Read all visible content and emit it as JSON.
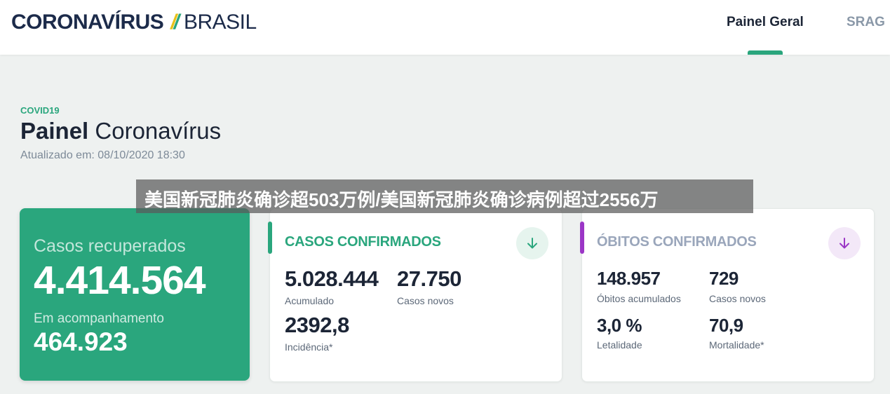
{
  "header": {
    "logo_main": "CORONAVÍRUS",
    "logo_sub": "BRASIL",
    "nav": [
      {
        "label": "Painel Geral",
        "active": true
      },
      {
        "label": "SRAG",
        "active": false
      }
    ]
  },
  "page": {
    "kicker": "COVID19",
    "title_bold": "Painel",
    "title_rest": "Coronavírus",
    "updated": "Atualizado em:  08/10/2020 18:30"
  },
  "recovered_card": {
    "label": "Casos recuperados",
    "value": "4.414.564",
    "followup_label": "Em acompanhamento",
    "followup_value": "464.923"
  },
  "confirmed_card": {
    "title": "CASOS CONFIRMADOS",
    "accent": "#2aa67d",
    "arrow_icon": "arrow-down-icon",
    "stats": [
      {
        "value": "5.028.444",
        "label": "Acumulado"
      },
      {
        "value": "27.750",
        "label": "Casos novos"
      },
      {
        "value": "2392,8",
        "label": "Incidência*"
      }
    ]
  },
  "deaths_card": {
    "title": "ÓBITOS CONFIRMADOS",
    "accent": "#9b36c6",
    "arrow_icon": "arrow-down-icon",
    "stats": [
      {
        "value": "148.957",
        "label": "Óbitos acumulados"
      },
      {
        "value": "729",
        "label": "Casos novos"
      },
      {
        "value": "3,0 %",
        "label": "Letalidade"
      },
      {
        "value": "70,9",
        "label": "Mortalidade*"
      }
    ]
  },
  "watermark": {
    "text": "美国新冠肺炎确诊超503万例/美国新冠肺炎确诊病例超过2556万"
  },
  "colors": {
    "brand_green": "#2aa67d",
    "brand_yellow": "#e8c21a",
    "deaths_purple": "#9b36c6",
    "confirmed_title": "#2aa67d",
    "deaths_title": "#9aa6bb"
  }
}
